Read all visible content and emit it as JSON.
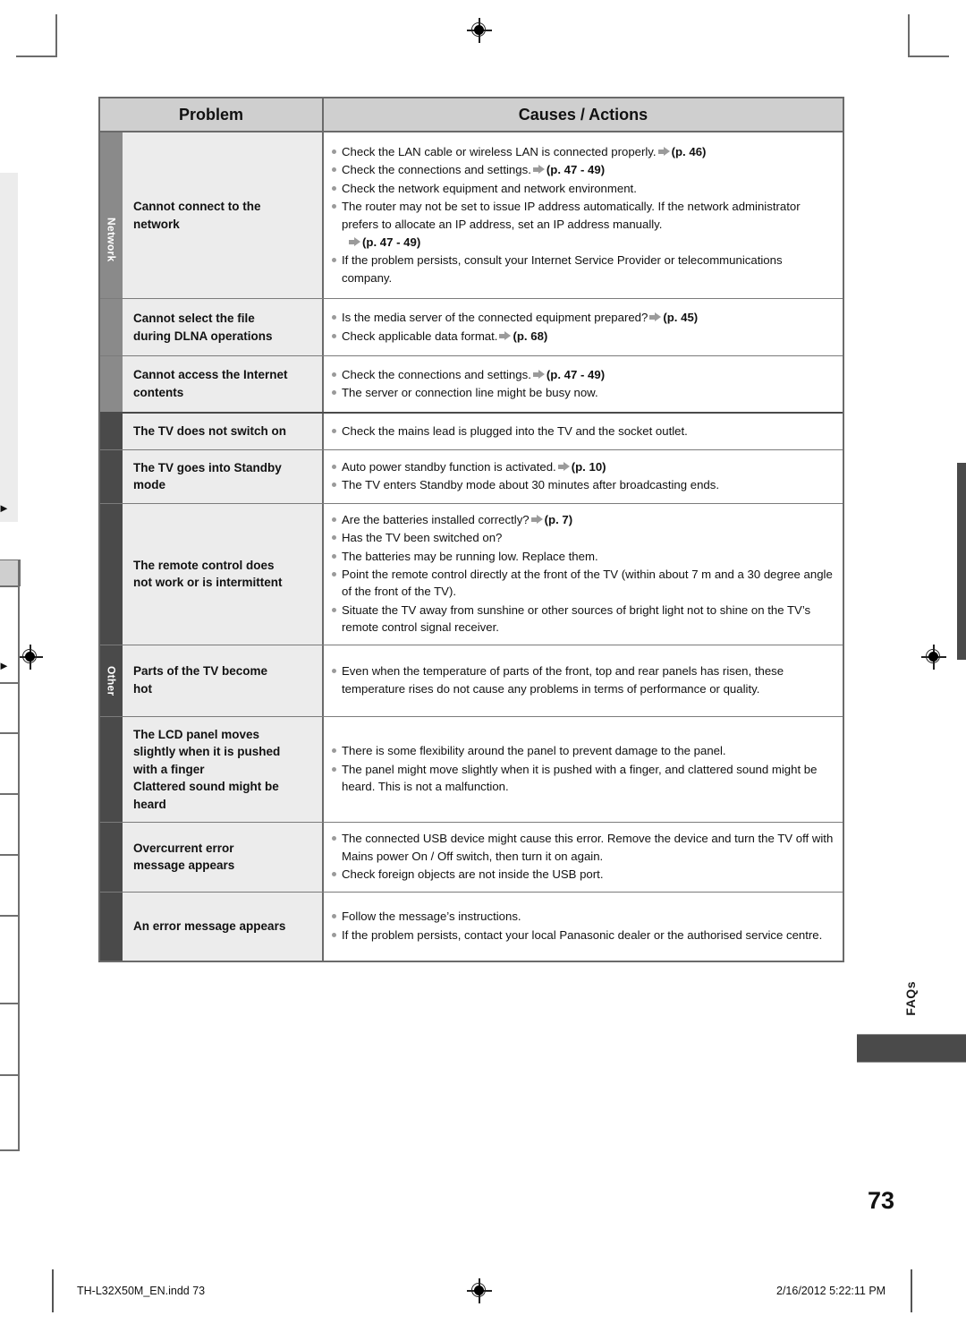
{
  "page": {
    "number": "73",
    "side_tab_label": "FAQs"
  },
  "table": {
    "headers": {
      "problem": "Problem",
      "causes": "Causes / Actions"
    },
    "groups": [
      {
        "id": "network",
        "label": "Network"
      },
      {
        "id": "other",
        "label": "Other"
      }
    ],
    "rows": [
      {
        "group": "network",
        "problem": "Cannot connect to the\nnetwork",
        "causes": [
          {
            "text": "Check the LAN cable or wireless LAN is connected properly.",
            "ref": "(p. 46)"
          },
          {
            "text": "Check the connections and settings.",
            "ref": "(p. 47 - 49)"
          },
          {
            "text": "Check the network equipment and network environment.",
            "ref": ""
          },
          {
            "text": "The router may not be set to issue IP address automatically. If the network administrator prefers to allocate an IP address, set an IP address manually.",
            "ref": ""
          },
          {
            "text": "",
            "ref": "(p. 47 - 49)",
            "continuation": true
          },
          {
            "text": "If the problem persists, consult your Internet Service Provider or telecommunications company.",
            "ref": ""
          }
        ]
      },
      {
        "group": "network",
        "problem": "Cannot select the file\nduring DLNA operations",
        "causes": [
          {
            "text": "Is the media server of the connected equipment prepared?",
            "ref": "(p. 45)"
          },
          {
            "text": "Check applicable data format.",
            "ref": "(p. 68)"
          }
        ]
      },
      {
        "group": "network",
        "problem": "Cannot access the Internet\ncontents",
        "causes": [
          {
            "text": "Check the connections and settings.",
            "ref": "(p. 47 - 49)"
          },
          {
            "text": "The server or connection line might be busy now.",
            "ref": ""
          }
        ]
      },
      {
        "group": "other",
        "problem": "The TV does not switch on",
        "causes": [
          {
            "text": "Check the mains lead is plugged into the TV and the socket outlet.",
            "ref": ""
          }
        ]
      },
      {
        "group": "other",
        "problem": "The TV goes into Standby\nmode",
        "causes": [
          {
            "text": "Auto power standby function is activated.",
            "ref": "(p. 10)"
          },
          {
            "text": "The TV enters Standby mode about 30 minutes after broadcasting ends.",
            "ref": ""
          }
        ]
      },
      {
        "group": "other",
        "problem": "The remote control does\nnot work or is intermittent",
        "causes": [
          {
            "text": "Are the batteries installed correctly?",
            "ref": "(p. 7)"
          },
          {
            "text": "Has the TV been switched on?",
            "ref": ""
          },
          {
            "text": "The batteries may be running low. Replace them.",
            "ref": ""
          },
          {
            "text": "Point the remote control directly at the front of the TV (within about 7 m and a 30 degree angle of the front of the TV).",
            "ref": ""
          },
          {
            "text": "Situate the TV away from sunshine or other sources of bright light not to shine on the TV’s remote control signal receiver.",
            "ref": ""
          }
        ]
      },
      {
        "group": "other",
        "problem": "Parts of the TV become\nhot",
        "causes": [
          {
            "text": "Even when the temperature of parts of the front, top and rear panels has risen, these temperature rises do not cause any problems in terms of performance or quality.",
            "ref": ""
          }
        ]
      },
      {
        "group": "other",
        "problem": "The LCD panel moves\nslightly when it is pushed\nwith a finger\nClattered sound might be\nheard",
        "causes": [
          {
            "text": "There is some flexibility around the panel to prevent damage to the panel.",
            "ref": ""
          },
          {
            "text": "The panel might move slightly when it is pushed with a finger, and clattered sound might be heard. This is not a malfunction.",
            "ref": ""
          }
        ]
      },
      {
        "group": "other",
        "problem": "Overcurrent error\nmessage appears",
        "causes": [
          {
            "text": "The connected USB device might cause this error. Remove the device and turn the TV off with Mains power On / Off switch, then turn it on again.",
            "ref": ""
          },
          {
            "text": "Check foreign objects are not inside the USB port.",
            "ref": ""
          }
        ]
      },
      {
        "group": "other",
        "problem": "An error message appears",
        "causes": [
          {
            "text": "Follow the message’s instructions.",
            "ref": ""
          },
          {
            "text": "If the problem persists, contact your local Panasonic dealer or the authorised service centre.",
            "ref": ""
          }
        ]
      }
    ]
  },
  "footer": {
    "file_name": "TH-L32X50M_EN.indd   73",
    "timestamp": "2/16/2012   5:22:11 PM"
  },
  "colors": {
    "header_bg": "#cfcfcf",
    "problem_bg": "#ececec",
    "network_tab": "#8a8a8a",
    "other_tab": "#4a4a4a",
    "border": "#6a6a6a",
    "bullet": "#9a9a9a"
  }
}
